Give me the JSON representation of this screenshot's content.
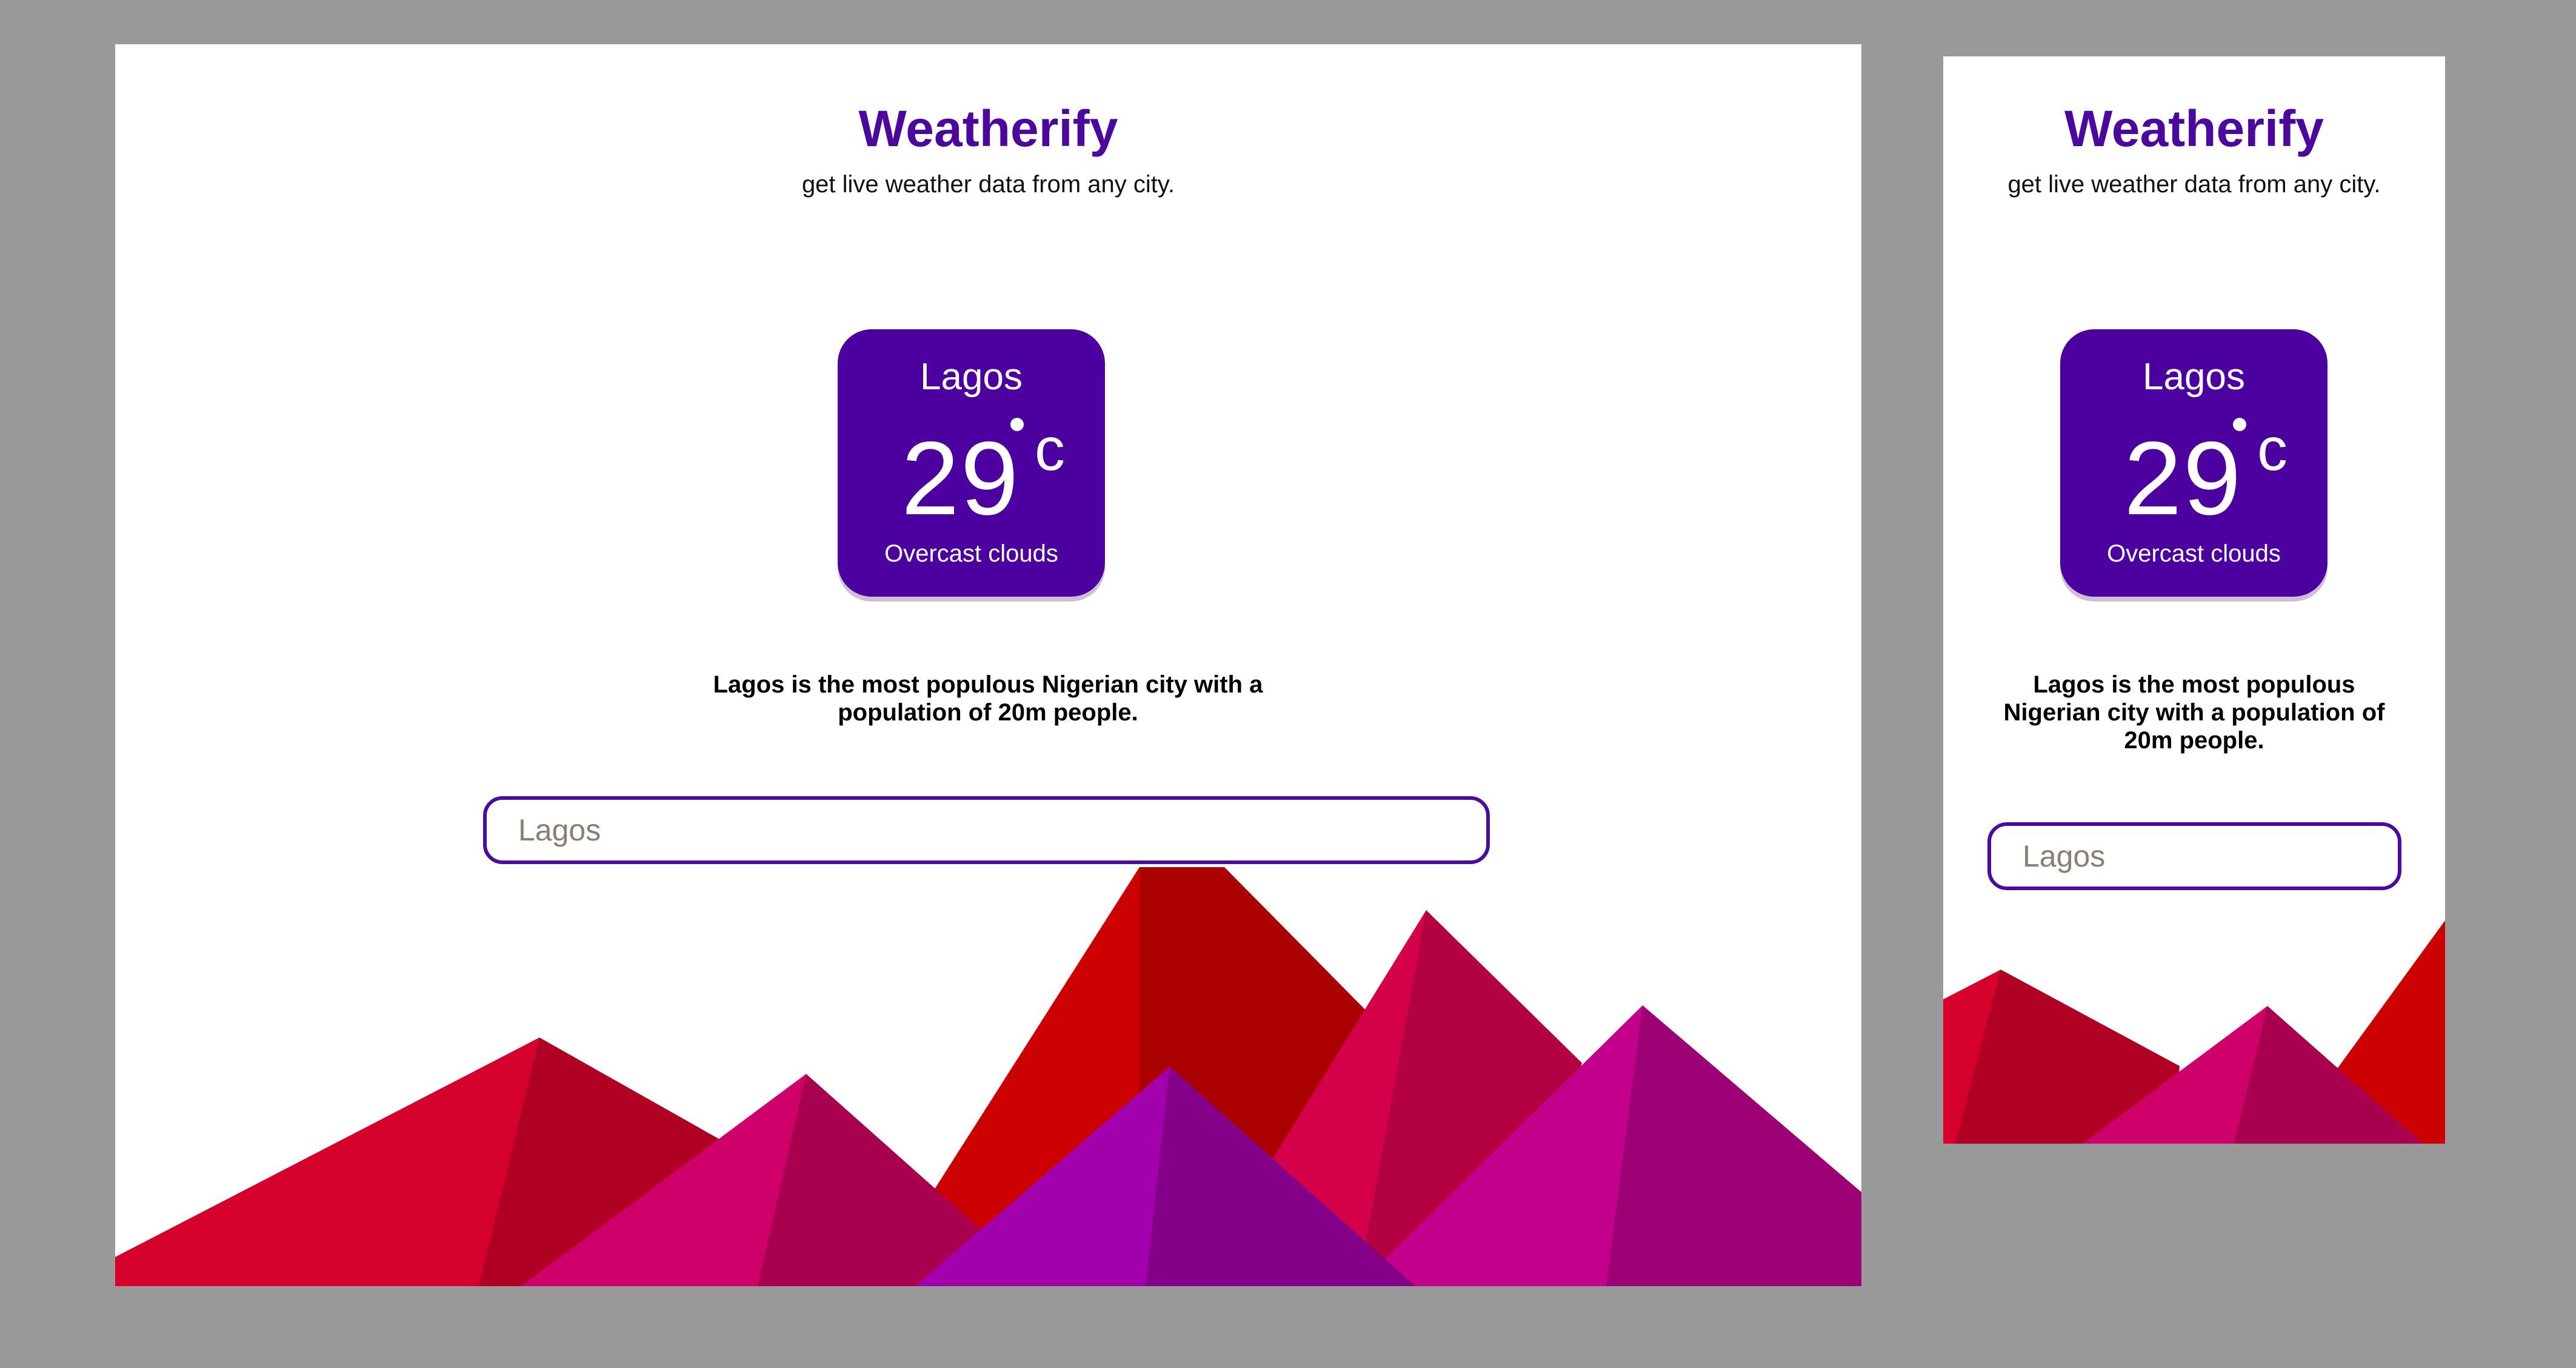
{
  "app": {
    "title": "Weatherify",
    "subtitle": "get live weather data from any city."
  },
  "weather": {
    "city": "Lagos",
    "temperature": "29",
    "unit": "c",
    "condition": "Overcast clouds"
  },
  "city_info": "Lagos is the most populous Nigerian city with a population of 20m people.",
  "search": {
    "placeholder": "Lagos"
  },
  "colors": {
    "brand": "#4c07a0",
    "background": "#999999",
    "card": "#4c00a0",
    "mountain_red": "#d6002a",
    "mountain_magenta": "#cf0070",
    "mountain_purple": "#a300ad"
  }
}
